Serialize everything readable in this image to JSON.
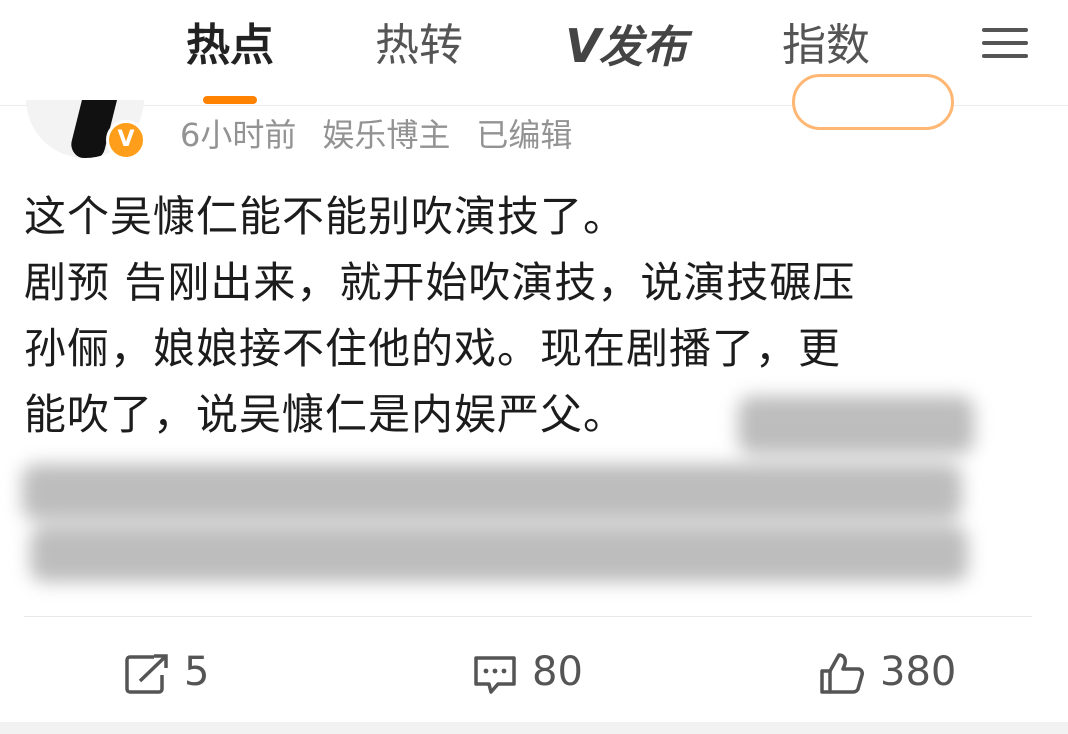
{
  "tabs": {
    "hot": "热点",
    "repost": "热转",
    "publish_logo": "V",
    "publish": "发布",
    "index": "指数"
  },
  "accent_color": "#ff8200",
  "post": {
    "time": "6小时前",
    "author_tag": "娱乐博主",
    "edited": "已编辑",
    "verified_badge": "V",
    "lines": [
      "这个吴慷仁能不能别吹演技了。",
      "剧预 告刚出来，就开始吹演技，说演技碾压",
      "孙俪，娘娘接不住他的戏。现在剧播了，更",
      "能吹了，说吴慷仁是内娱严父。"
    ]
  },
  "actions": {
    "repost_count": "5",
    "comment_count": "80",
    "like_count": "380"
  },
  "icons": [
    "menu-icon",
    "verified-icon",
    "repost-icon",
    "comment-icon",
    "like-icon"
  ]
}
